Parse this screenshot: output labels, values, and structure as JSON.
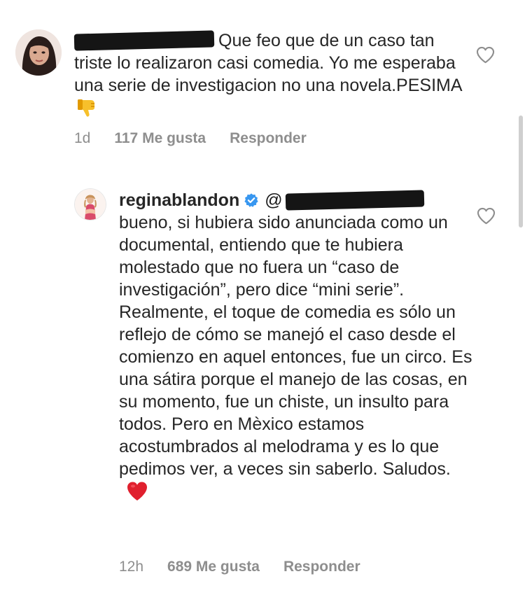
{
  "comments": [
    {
      "username": "",
      "text": "Que feo que de un caso tan triste lo realizaron casi comedia. Yo me esperaba una serie de investigacion no una novela.PESIMA",
      "emoji": "thumbs-down-icon",
      "time": "1d",
      "likes": "117 Me gusta",
      "reply": "Responder"
    },
    {
      "username": "reginablandon",
      "verified": true,
      "mention_prefix": "@",
      "text": "bueno, si hubiera sido anunciada como un documental, entiendo que te hubiera molestado que no fuera un “caso de investigación”, pero dice “mini serie”. Realmente, el toque de comedia es sólo un reflejo de cómo se manejó el caso desde el comienzo en aquel entonces, fue un circo. Es una sátira porque el manejo de las cosas, en su momento, fue un chiste, un insulto para todos. Pero en Mèxico estamos acostumbrados al melodrama y es lo que pedimos ver, a veces sin saberlo. Saludos.",
      "emoji": "red-heart-icon",
      "time": "12h",
      "likes": "689 Me gusta",
      "reply": "Responder"
    }
  ],
  "colors": {
    "text": "#262626",
    "meta": "#8e8e8e",
    "verified": "#3897f0",
    "heart_emoji": "#e0202e",
    "thumbs_emoji": "#f4b400"
  }
}
